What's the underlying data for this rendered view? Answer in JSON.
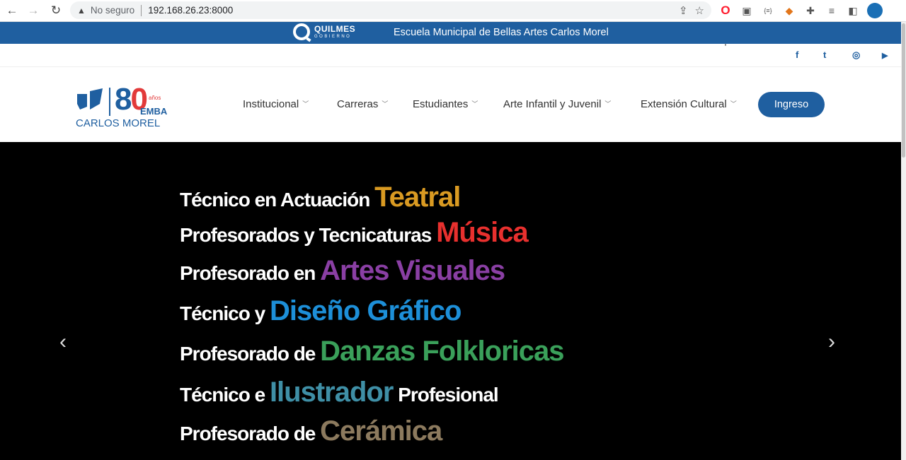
{
  "browser": {
    "security_label": "No seguro",
    "url": "192.168.26.23:8000"
  },
  "top_band": {
    "brand_line1": "QUILMES",
    "brand_line2": "GOBIERNO",
    "title": "Escuela Municipal de Bellas Artes Carlos Morel"
  },
  "social": {
    "facebook": "f",
    "twitter": "t",
    "instagram": "◎",
    "youtube": "▶"
  },
  "logo": {
    "number_eight": "8",
    "number_zero": "0",
    "anos": "años",
    "emba": "EMBA",
    "name": "CARLOS MOREL"
  },
  "nav": {
    "items": [
      {
        "label": "Institucional"
      },
      {
        "label": "Carreras"
      },
      {
        "label": "Estudiantes"
      },
      {
        "label": "Arte Infantil y Juvenil"
      },
      {
        "label": "Extensión Cultural"
      }
    ],
    "button": "Ingreso"
  },
  "hero": {
    "lines": [
      {
        "lead": "Técnico en Actuación ",
        "highlight": "Teatral",
        "trail": "",
        "color": "#d99a22"
      },
      {
        "lead": "Profesorados  y Tecnicaturas ",
        "highlight": "Música",
        "trail": "",
        "color": "#e8302e"
      },
      {
        "lead": "Profesorado en ",
        "highlight": "Artes Visuales",
        "trail": "",
        "color": "#8a3fa4"
      },
      {
        "lead": "Técnico y ",
        "highlight": "Diseño Gráfico",
        "trail": "",
        "color": "#1d8fd8"
      },
      {
        "lead": "Profesorado de ",
        "highlight": "Danzas Folkloricas",
        "trail": "",
        "color": "#3aa05a"
      },
      {
        "lead": "Técnico e ",
        "highlight": "Ilustrador",
        "trail": " Profesional",
        "color": "#3f8fa6"
      },
      {
        "lead": "Profesorado de ",
        "highlight": "Cerámica",
        "trail": "",
        "color": "#8c7a5e"
      }
    ]
  },
  "colors": {
    "brand_blue": "#1f5fa0",
    "accent_red": "#e23a3a"
  }
}
